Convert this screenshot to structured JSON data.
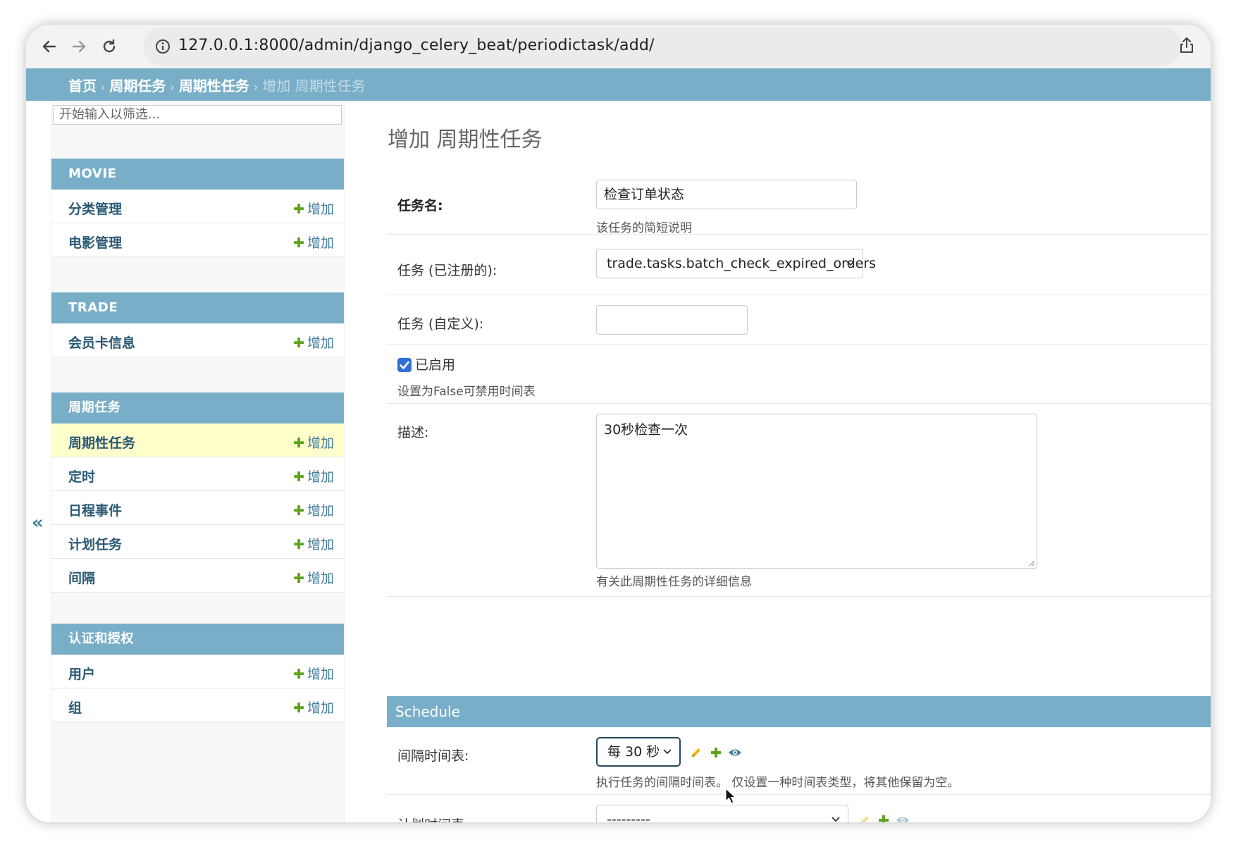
{
  "browser": {
    "url": "127.0.0.1:8000/admin/django_celery_beat/periodictask/add/"
  },
  "breadcrumbs": {
    "home": "首页",
    "app": "周期任务",
    "model": "周期性任务",
    "current": "增加 周期性任务"
  },
  "sidebar": {
    "filter_placeholder": "开始输入以筛选...",
    "collapse_label": "«",
    "add_label": "增加",
    "modules": [
      {
        "title": "MOVIE",
        "items": [
          "分类管理",
          "电影管理"
        ]
      },
      {
        "title": "TRADE",
        "items": [
          "会员卡信息"
        ]
      },
      {
        "title": "周期任务",
        "items": [
          "周期性任务",
          "定时",
          "日程事件",
          "计划任务",
          "间隔"
        ]
      },
      {
        "title": "认证和授权",
        "items": [
          "用户",
          "组"
        ]
      }
    ],
    "selected_item": "周期性任务"
  },
  "form": {
    "title": "增加 周期性任务",
    "name_label": "任务名:",
    "name_value": "检查订单状态",
    "name_help": "该任务的简短说明",
    "task_registered_label": "任务 (已注册的):",
    "task_registered_value": "trade.tasks.batch_check_expired_orders",
    "task_custom_label": "任务 (自定义):",
    "task_custom_value": "",
    "enabled_label": "已启用",
    "enabled_checked": true,
    "enabled_help": "设置为False可禁用时间表",
    "description_label": "描述:",
    "description_value": "30秒检查一次",
    "description_help": "有关此周期性任务的详细信息",
    "schedule_header": "Schedule",
    "interval_label": "间隔时间表:",
    "interval_value": "每 30 秒",
    "interval_help": "执行任务的间隔时间表。 仅设置一种时间表类型，将其他保留为空。",
    "crontab_label": "计划时间表:",
    "crontab_value": "---------"
  },
  "colors": {
    "header_blue": "#79aec8",
    "link_blue": "#447e9b",
    "add_green": "#5da31b",
    "selected_row": "#ffffcc",
    "focus_blue": "#264b5d"
  }
}
